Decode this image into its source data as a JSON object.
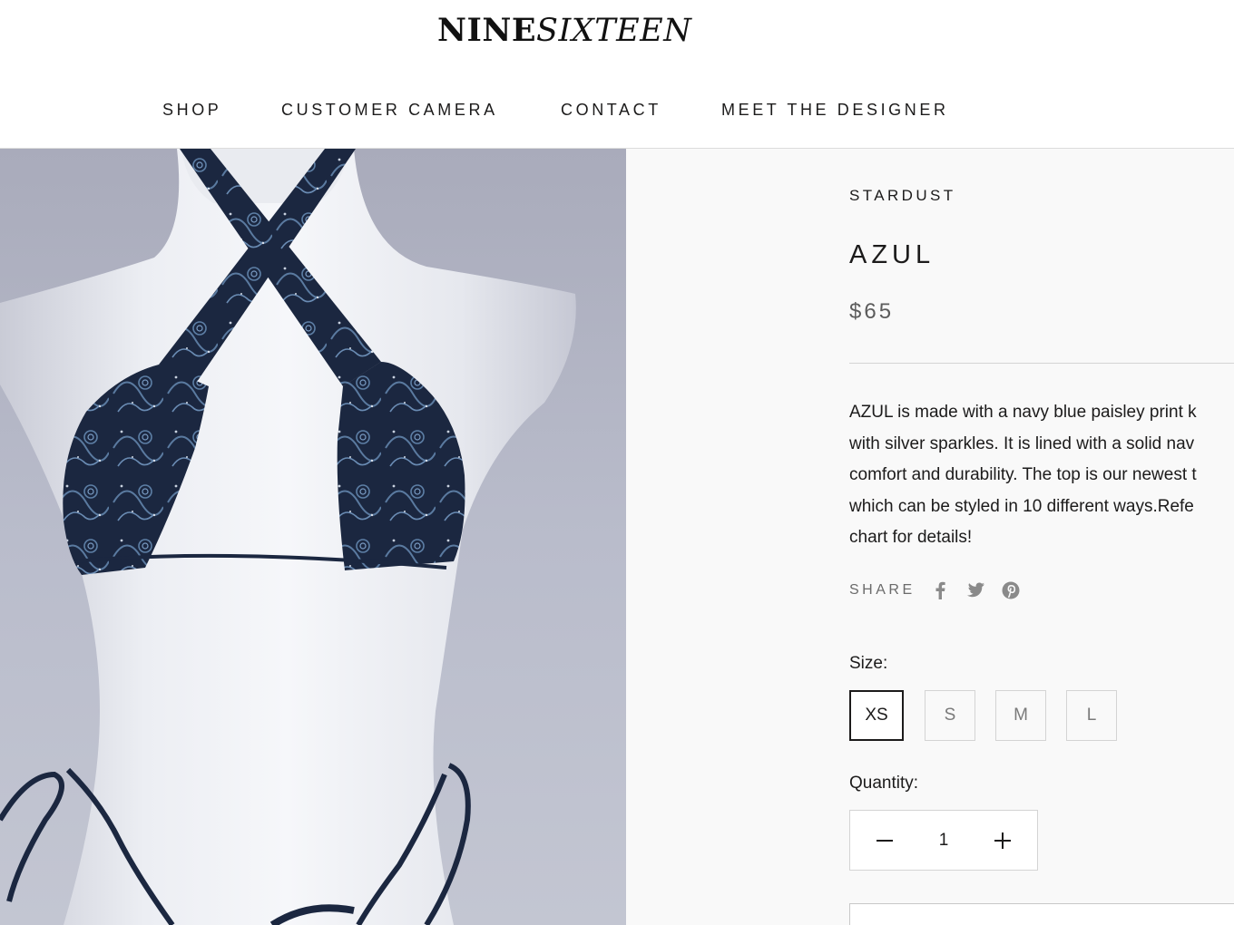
{
  "header": {
    "logo_bold": "NINE",
    "logo_italic": "SIXTEEN",
    "nav": [
      {
        "label": "SHOP"
      },
      {
        "label": "CUSTOMER CAMERA"
      },
      {
        "label": "CONTACT"
      },
      {
        "label": "MEET THE DESIGNER"
      }
    ]
  },
  "product": {
    "vendor": "STARDUST",
    "title": "AZUL",
    "price": "$65",
    "description_lines": [
      "AZUL is made with a navy blue paisley print k",
      "with silver sparkles. It is lined with a solid nav",
      "comfort and durability. The top is our newest t",
      "which can be styled in 10 different ways.Refe",
      "chart for details!"
    ],
    "share": {
      "label": "SHARE",
      "icons": [
        "facebook-icon",
        "twitter-icon",
        "pinterest-icon"
      ]
    },
    "size": {
      "label": "Size:",
      "options": [
        "XS",
        "S",
        "M",
        "L"
      ],
      "selected": "XS"
    },
    "quantity": {
      "label": "Quantity:",
      "value": "1"
    }
  },
  "colors": {
    "text": "#1c1b1b",
    "muted": "#5c5c5c",
    "border": "#d4d4d4",
    "panel_bg": "#f9f9f9",
    "fabric": "#1e2c44"
  }
}
